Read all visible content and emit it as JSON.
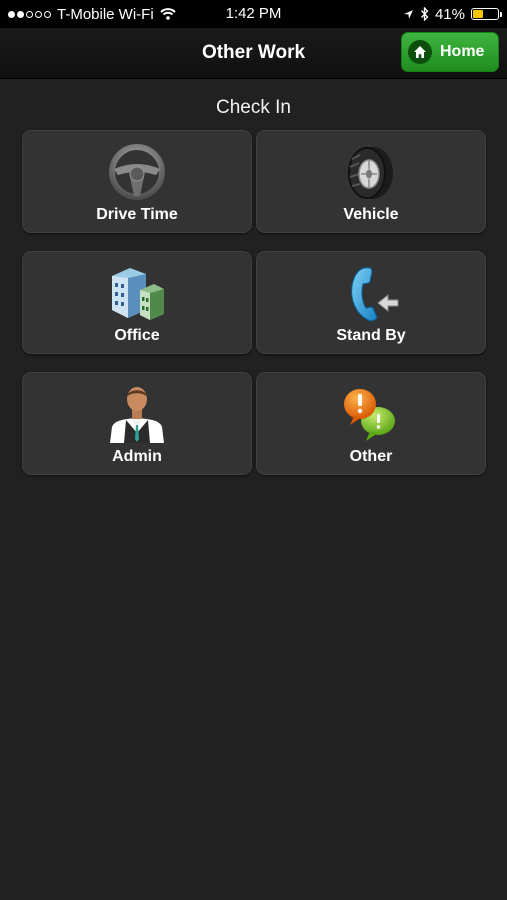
{
  "status_bar": {
    "carrier": "T-Mobile Wi-Fi",
    "time": "1:42 PM",
    "battery": "41%",
    "battery_level": 0.41,
    "signal_bars": 2,
    "signal_total": 5
  },
  "header": {
    "title": "Other Work",
    "home_label": "Home",
    "accent_color": "#2a9d2a"
  },
  "section": {
    "title": "Check In"
  },
  "tiles": [
    {
      "label": "Drive Time",
      "icon": "steering-wheel-icon"
    },
    {
      "label": "Vehicle",
      "icon": "tire-icon"
    },
    {
      "label": "Office",
      "icon": "office-building-icon"
    },
    {
      "label": "Stand By",
      "icon": "phone-icon"
    },
    {
      "label": "Admin",
      "icon": "person-icon"
    },
    {
      "label": "Other",
      "icon": "chat-bubbles-icon"
    }
  ]
}
